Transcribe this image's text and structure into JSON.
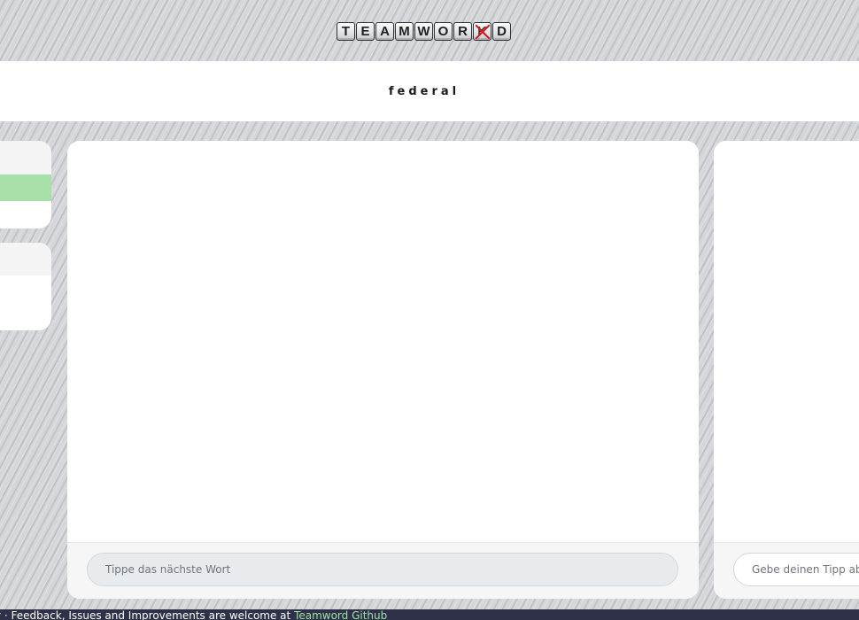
{
  "logo": {
    "letters": [
      "T",
      "E",
      "A",
      "M",
      "W",
      "O",
      "R",
      "K",
      "D"
    ],
    "struck_letter_index": 7
  },
  "word_banner": {
    "word": "federal"
  },
  "chat": {
    "input_placeholder": "Tippe das nächste Wort"
  },
  "guess": {
    "input_placeholder": "Gebe deinen Tipp ab"
  },
  "footer": {
    "text": "y · Feedback, Issues and Improvements are welcome at ",
    "link_label": "Teamword Github"
  },
  "colors": {
    "highlight_row": "#a6e0a8",
    "footer_bg": "#2e3148",
    "footer_link": "#9fe0a6",
    "strike": "#d2141b"
  }
}
